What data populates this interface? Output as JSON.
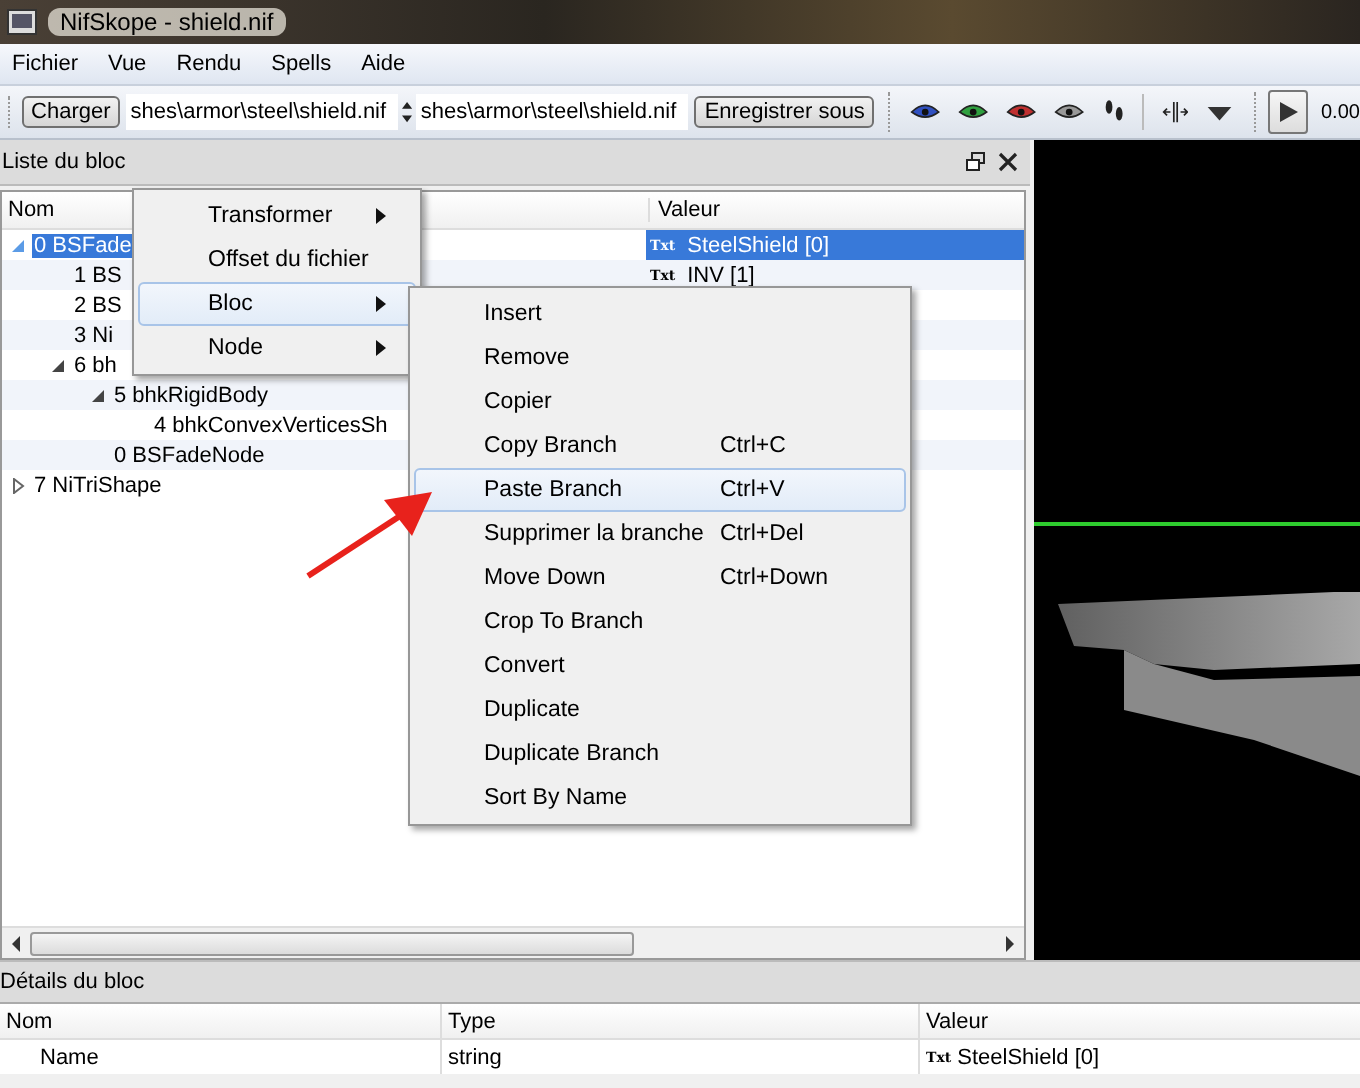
{
  "window": {
    "title": "NifSkope - shield.nif"
  },
  "menu": [
    "Fichier",
    "Vue",
    "Rendu",
    "Spells",
    "Aide"
  ],
  "toolbar": {
    "load_button": "Charger",
    "load_path": "shes\\armor\\steel\\shield.nif",
    "save_path": "shes\\armor\\steel\\shield.nif",
    "save_button": "Enregistrer sous",
    "time": "0.00"
  },
  "block_list": {
    "title": "Liste du bloc",
    "columns": [
      "Nom",
      "Valeur"
    ],
    "rows": [
      {
        "name": "0 BSFade",
        "value_tag": "Txt",
        "value": "SteelShield [0]",
        "selected": true,
        "expanded": true,
        "children": [
          {
            "name": "1 BS",
            "value_tag": "Txt",
            "value": "INV [1]",
            "selected": false
          },
          {
            "name": "2 BS",
            "selected": false
          },
          {
            "name": "3 Ni",
            "selected": false
          },
          {
            "name": "6 bh",
            "selected": false,
            "expanded": true,
            "children": [
              {
                "name": "5 bhkRigidBody",
                "selected": false,
                "expanded": true,
                "children": [
                  {
                    "name": "4 bhkConvexVerticesSh",
                    "selected": false
                  }
                ]
              },
              {
                "name": "0 BSFadeNode",
                "selected": false
              }
            ]
          }
        ]
      },
      {
        "name": "7 NiTriShape",
        "selected": false,
        "expanded": false
      }
    ]
  },
  "context_menu": {
    "items": [
      {
        "label": "Transformer",
        "has_submenu": true,
        "highlighted": false
      },
      {
        "label": "Offset du fichier",
        "has_submenu": false,
        "highlighted": false
      },
      {
        "label": "Bloc",
        "has_submenu": true,
        "highlighted": true
      },
      {
        "label": "Node",
        "has_submenu": true,
        "highlighted": false
      }
    ]
  },
  "submenu": {
    "items": [
      {
        "label": "Insert",
        "highlighted": false
      },
      {
        "label": "Remove",
        "highlighted": false
      },
      {
        "label": "Copier",
        "highlighted": false
      },
      {
        "label": "Copy Branch",
        "shortcut": "Ctrl+C",
        "highlighted": false
      },
      {
        "label": "Paste Branch",
        "shortcut": "Ctrl+V",
        "highlighted": true
      },
      {
        "label": "Supprimer la branche",
        "shortcut": "Ctrl+Del",
        "highlighted": false
      },
      {
        "label": "Move Down",
        "shortcut": "Ctrl+Down",
        "highlighted": false
      },
      {
        "label": "Crop To Branch",
        "highlighted": false
      },
      {
        "label": "Convert",
        "highlighted": false
      },
      {
        "label": "Duplicate",
        "highlighted": false
      },
      {
        "label": "Duplicate Branch",
        "highlighted": false
      },
      {
        "label": "Sort By Name",
        "highlighted": false
      }
    ]
  },
  "block_details": {
    "title": "Détails du bloc",
    "columns": [
      "Nom",
      "Type",
      "Valeur"
    ],
    "rows": [
      {
        "name": "Name",
        "type": "string",
        "value_tag": "Txt",
        "value": "SteelShield [0]"
      }
    ]
  }
}
